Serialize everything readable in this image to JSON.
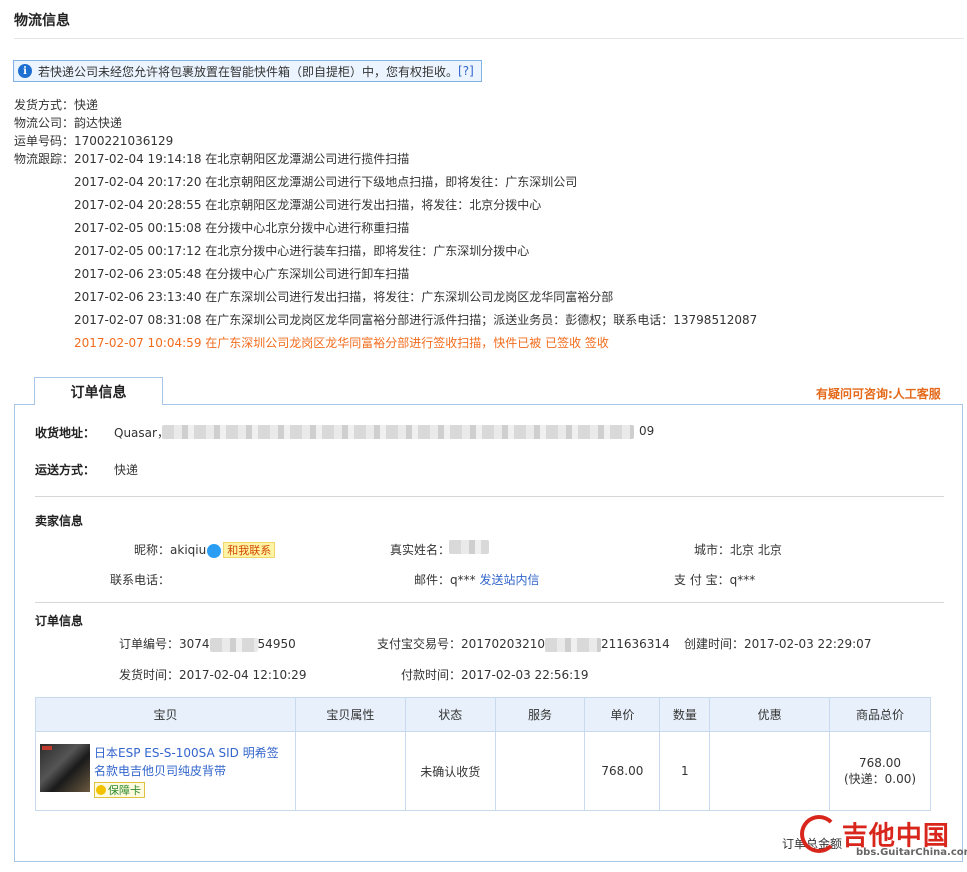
{
  "section": {
    "title": "物流信息"
  },
  "notice": {
    "icon": "info-icon",
    "text": "若快递公司未经您允许将包裹放置在智能快件箱（即自提柜）中，您有权拒收。",
    "help": "[?]"
  },
  "shipping": {
    "method": "发货方式：快递",
    "company": "物流公司：韵达快递",
    "waybill": "运单号码：1700221036129",
    "trace_label": "物流跟踪：",
    "events": [
      "2017-02-04 19:14:18 在北京朝阳区龙潭湖公司进行揽件扫描",
      "2017-02-04 20:17:20 在北京朝阳区龙潭湖公司进行下级地点扫描，即将发往：广东深圳公司",
      "2017-02-04 20:28:55 在北京朝阳区龙潭湖公司进行发出扫描，将发往：北京分拨中心",
      "2017-02-05 00:15:08 在分拨中心北京分拨中心进行称重扫描",
      "2017-02-05 00:17:12 在北京分拨中心进行装车扫描，即将发往：广东深圳分拨中心",
      "2017-02-06 23:05:48 在分拨中心广东深圳公司进行卸车扫描",
      "2017-02-06 23:13:40 在广东深圳公司进行发出扫描，将发往：广东深圳公司龙岗区龙华同富裕分部",
      "2017-02-07 08:31:08 在广东深圳公司龙岗区龙华同富裕分部进行派件扫描；派送业务员：彭德权；联系电话：13798512087",
      "2017-02-07 10:04:59 在广东深圳公司龙岗区龙华同富裕分部进行签收扫描，快件已被 已签收 签收"
    ]
  },
  "order": {
    "tab": "订单信息",
    "help_link": "有疑问可咨询:人工客服",
    "address_label": "收货地址：",
    "address_name": "Quasar，",
    "address_tail": "09",
    "ship_label": "运送方式：",
    "ship_value": "快递",
    "seller_title": "卖家信息",
    "nickname_label": "昵称：",
    "nickname": "akiqiu",
    "contact_me": "和我联系",
    "realname_label": "真实姓名：",
    "city": "城市：北京 北京",
    "phone_label": "联系电话：",
    "email_label": "邮件：q***",
    "send_msg": "发送站内信",
    "alipay": "支 付 宝：q***",
    "order_title": "订单信息",
    "order_no_prefix": "订单编号：3074",
    "order_no_suffix": "54950",
    "alipay_trade_prefix": "支付宝交易号：20170203210",
    "alipay_trade_suffix": "211636314",
    "created": "创建时间：2017-02-03 22:29:07",
    "shipped": "发货时间：2017-02-04 12:10:29",
    "paid": "付款时间：2017-02-03 22:56:19",
    "table": {
      "headers": [
        "宝贝",
        "宝贝属性",
        "状态",
        "服务",
        "单价",
        "数量",
        "优惠",
        "商品总价"
      ],
      "row": {
        "product": "日本ESP ES-S-100SA SID 明希签名款电吉他贝司纯皮背带",
        "guarantee": "保障卡",
        "attr": "",
        "status": "未确认收货",
        "service": "",
        "price": "768.00",
        "qty": "1",
        "discount": "",
        "total": "768.00",
        "shipping": "(快递：0.00)"
      }
    },
    "total_label": "订单总金额"
  },
  "watermark": {
    "cn": "吉他中国",
    "url": "bbs.GuitarChina.com"
  }
}
